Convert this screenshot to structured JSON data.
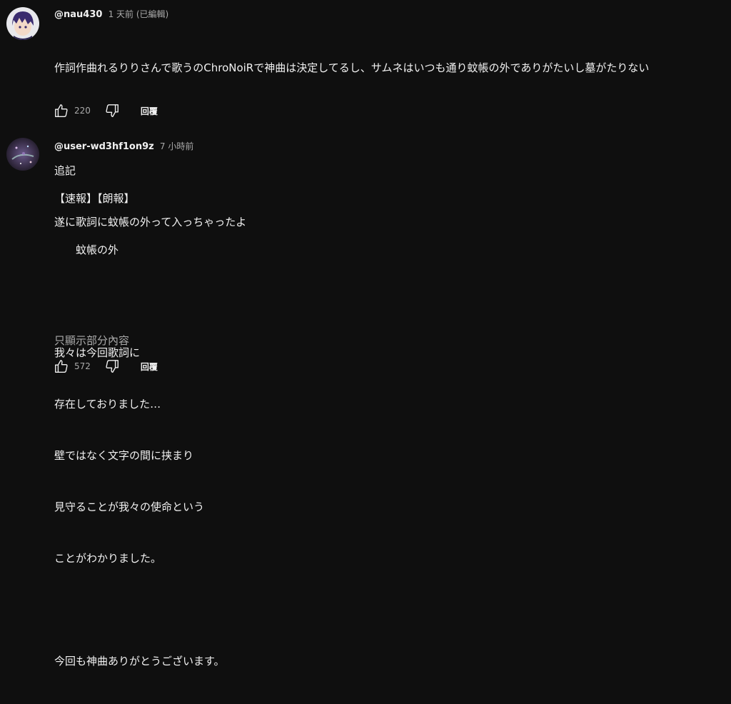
{
  "comments": [
    {
      "author": "@nau430",
      "time": "1 天前 (已編輯)",
      "lines": [
        "作詞作曲れるりりさんで歌うのChroNoiRで神曲は決定してるし、サムネはいつも通り蚊帳の外でありがたいし墓がたりない",
        "",
        "追記",
        "遂に歌詞に蚊帳の外って入っちゃったよ"
      ],
      "likes": "220",
      "reply_label": "回覆",
      "avatar_colors": {
        "bg": "#e8e8ec",
        "hair": "#3a2b6e",
        "face": "#f3d9c8"
      }
    },
    {
      "author": "@user-wd3hf1on9z",
      "time": "7 小時前",
      "lines": [
        "【速報】【朗報】",
        "　　蚊帳の外",
        "",
        "我々は今回歌詞に",
        "存在しておりました…",
        "壁ではなく文字の間に挟まり",
        "見守ることが我々の使命という",
        "ことがわかりました。",
        "",
        "今回も神曲ありがとうございます。"
      ],
      "show_less": "只顯示部分內容",
      "likes": "572",
      "reply_label": "回覆",
      "avatar_colors": {
        "bg": "#2a2233",
        "accent": "#7a5aa0",
        "glow": "#b0d8d0"
      }
    }
  ],
  "icons": {
    "like": "thumb-up-icon",
    "dislike": "thumb-down-icon"
  }
}
